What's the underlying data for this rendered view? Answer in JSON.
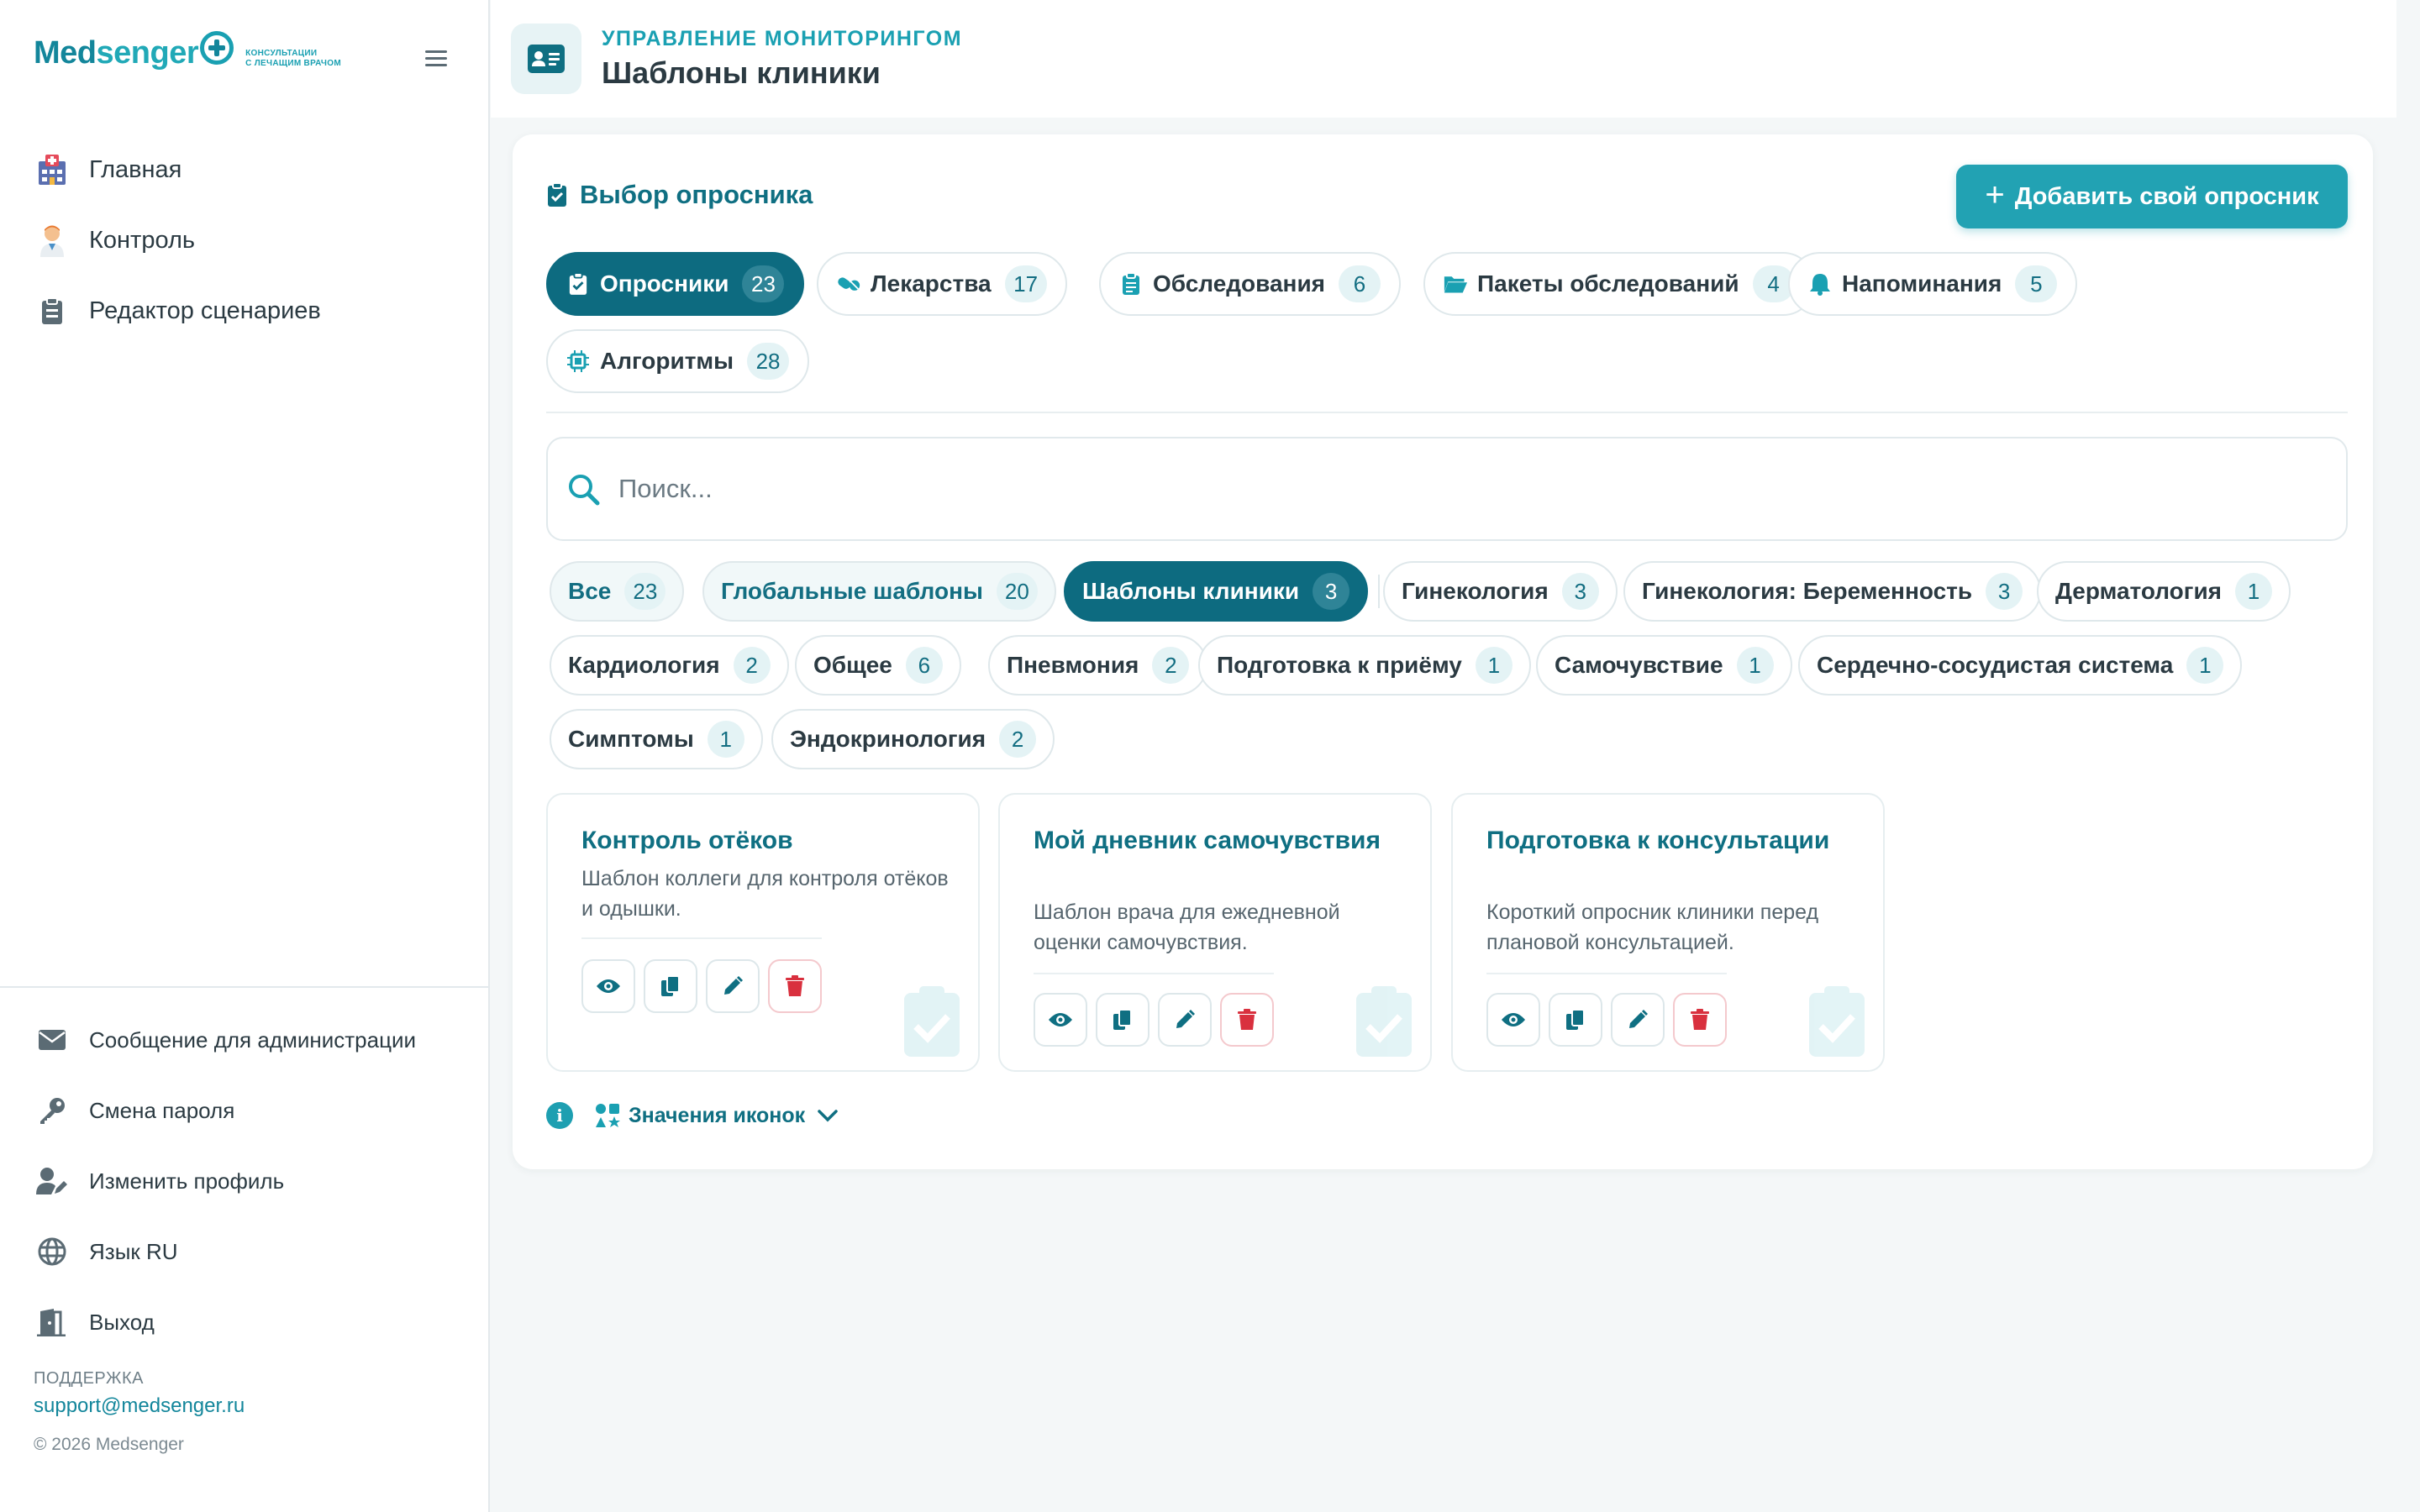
{
  "brand": {
    "name_part1": "Med",
    "name_part2": "senger",
    "tagline_line1": "КОНСУЛЬТАЦИИ",
    "tagline_line2": "С ЛЕЧАЩИМ ВРАЧОМ"
  },
  "sidebar": {
    "items": [
      {
        "label": "Главная",
        "icon": "hospital-icon"
      },
      {
        "label": "Контроль",
        "icon": "doctor-icon"
      },
      {
        "label": "Редактор сценариев",
        "icon": "clipboard-icon"
      }
    ],
    "bottom_items": [
      {
        "label": "Сообщение для администрации",
        "icon": "envelope-icon"
      },
      {
        "label": "Смена пароля",
        "icon": "key-icon"
      },
      {
        "label": "Изменить профиль",
        "icon": "user-edit-icon"
      },
      {
        "label": "Язык RU",
        "icon": "globe-icon"
      },
      {
        "label": "Выход",
        "icon": "door-exit-icon"
      }
    ],
    "support_title": "ПОДДЕРЖКА",
    "support_email": "support@medsenger.ru",
    "copyright": "© 2026 Medsenger"
  },
  "header": {
    "eyebrow": "УПРАВЛЕНИЕ МОНИТОРИНГОМ",
    "title": "Шаблоны клиники"
  },
  "main": {
    "section_title": "Выбор опросника",
    "add_button": "Добавить свой опросник",
    "type_tabs": [
      {
        "label": "Опросники",
        "count": "23",
        "active": true
      },
      {
        "label": "Лекарства",
        "count": "17"
      },
      {
        "label": "Обследования",
        "count": "6"
      },
      {
        "label": "Пакеты обследований",
        "count": "4"
      },
      {
        "label": "Напоминания",
        "count": "5"
      },
      {
        "label": "Алгоритмы",
        "count": "28"
      }
    ],
    "search_placeholder": "Поиск...",
    "filters": [
      {
        "label": "Все",
        "count": "23"
      },
      {
        "label": "Глобальные шаблоны",
        "count": "20"
      },
      {
        "label": "Шаблоны клиники",
        "count": "3",
        "active": true
      },
      {
        "label": "Гинекология",
        "count": "3"
      },
      {
        "label": "Гинекология: Беременность",
        "count": "3"
      },
      {
        "label": "Дерматология",
        "count": "1"
      },
      {
        "label": "Кардиология",
        "count": "2"
      },
      {
        "label": "Общее",
        "count": "6"
      },
      {
        "label": "Пневмония",
        "count": "2"
      },
      {
        "label": "Подготовка к приёму",
        "count": "1"
      },
      {
        "label": "Самочувствие",
        "count": "1"
      },
      {
        "label": "Сердечно-сосудистая система",
        "count": "1"
      },
      {
        "label": "Симптомы",
        "count": "1"
      },
      {
        "label": "Эндокринология",
        "count": "2"
      }
    ],
    "cards": [
      {
        "title": "Контроль отёков",
        "description": "Шаблон коллеги для контроля отёков и одышки."
      },
      {
        "title": "Мой дневник самочувствия",
        "description": "Шаблон врача для ежедневной оценки самочувствия."
      },
      {
        "title": "Подготовка к консультации",
        "description": "Короткий опросник клиники перед плановой консультацией."
      }
    ],
    "legend_label": "Значения иконок"
  },
  "colors": {
    "brand_dark": "#0d6b80",
    "brand_accent": "#22a2b3",
    "danger": "#d9303e"
  }
}
